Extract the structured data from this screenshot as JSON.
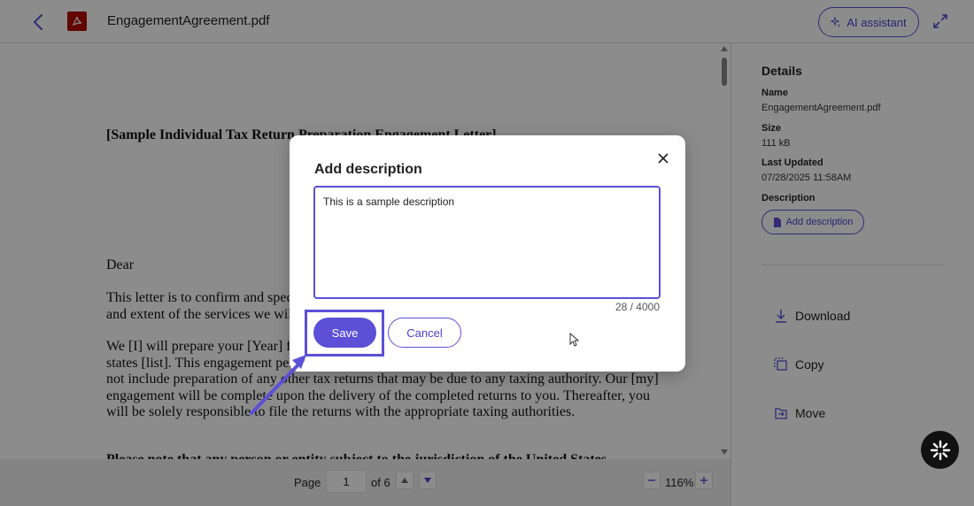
{
  "header": {
    "file_title": "EngagementAgreement.pdf",
    "ai_button_label": "AI assistant"
  },
  "document": {
    "title": "[Sample Individual Tax Return Preparation Engagement Letter]",
    "salutation": "Dear",
    "para1": "This letter is to confirm and specify the terms of our engagement with you and to clarify the nature and extent of the services we will provide.",
    "para2": "We [I] will prepare your [Year] federal and state [specify] individual income tax returns for the states [list]. This engagement pertains only to the [Year] tax year, and our [my] responsibilities do not include preparation of any other tax returns that may be due to any taxing authority.  Our [my] engagement will be complete upon the delivery of the completed returns to you.  Thereafter, you will be solely responsible to file the returns with the appropriate taxing authorities.",
    "para3": "Please note that any person or entity subject to the jurisdiction of the United States"
  },
  "pager": {
    "page_label": "Page",
    "page_value": "1",
    "of_label": "of 6",
    "zoom_value": "116%"
  },
  "details": {
    "title": "Details",
    "name_label": "Name",
    "name_value": "EngagementAgreement.pdf",
    "size_label": "Size",
    "size_value": "111 kB",
    "updated_label": "Last Updated",
    "updated_value": "07/28/2025 11:58AM",
    "description_label": "Description",
    "add_description_label": "Add description",
    "actions": {
      "download": "Download",
      "copy": "Copy",
      "move": "Move"
    }
  },
  "modal": {
    "title": "Add description",
    "textarea_value": "This is a sample description",
    "char_count": "28 / 4000",
    "save_label": "Save",
    "cancel_label": "Cancel"
  },
  "colors": {
    "accent": "#5b50d6",
    "pdf_red": "#b30b00",
    "overlay": "rgba(0,0,0,0.45)"
  }
}
